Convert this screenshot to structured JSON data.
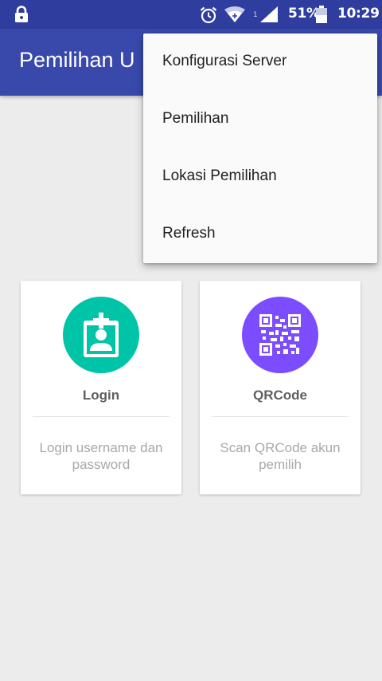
{
  "status_bar": {
    "icons": [
      "lock-icon",
      "alarm-icon",
      "wifi-icon",
      "signal-icon",
      "battery-icon"
    ],
    "network_small": "1",
    "battery_percent": "51%",
    "time": "10:29"
  },
  "app_bar": {
    "title": "Pemilihan U",
    "color": "#3949ab",
    "status_color": "#2f3e9e"
  },
  "menu": {
    "items": [
      {
        "label": "Konfigurasi Server"
      },
      {
        "label": "Pemilihan"
      },
      {
        "label": "Lokasi Pemilihan"
      },
      {
        "label": "Refresh"
      }
    ]
  },
  "cards": [
    {
      "title": "Login",
      "description": "Login username dan password",
      "icon": "id-badge-icon",
      "color": "#00c4a7"
    },
    {
      "title": "QRCode",
      "description": "Scan QRCode akun pemilih",
      "icon": "qrcode-icon",
      "color": "#7c4dff"
    }
  ]
}
